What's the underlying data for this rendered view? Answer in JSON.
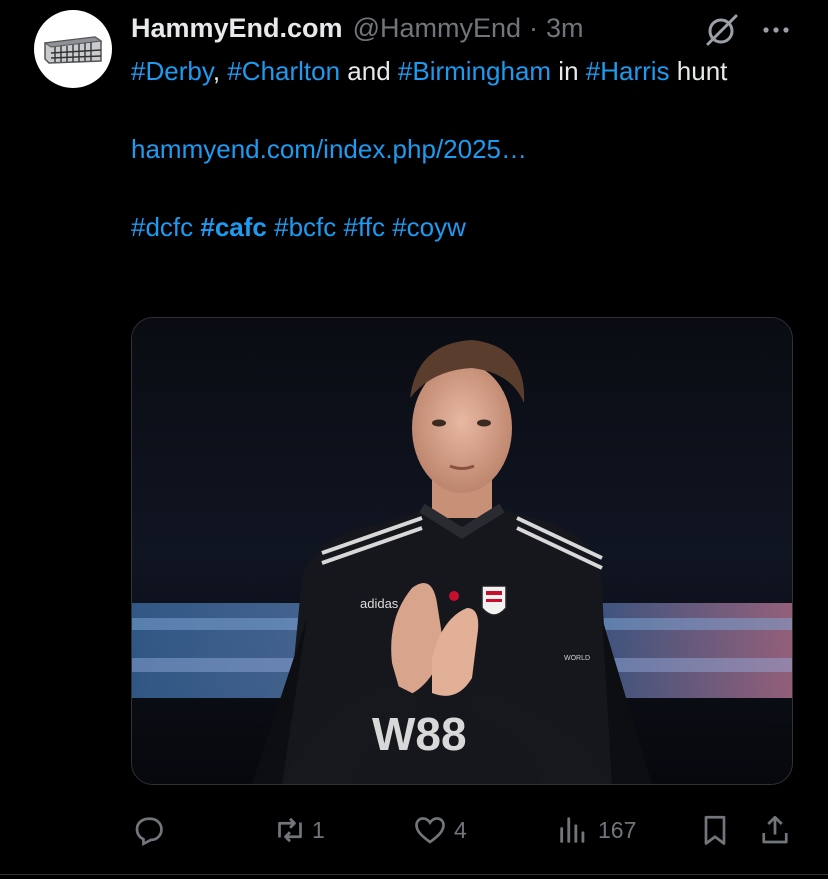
{
  "author": {
    "name": "HammyEnd.com",
    "handle": "@HammyEnd",
    "separator": "·",
    "time": "3m"
  },
  "tweet": {
    "line1": [
      {
        "t": "#Derby",
        "type": "tag"
      },
      {
        "t": ", ",
        "type": "text"
      },
      {
        "t": "#Charlton",
        "type": "tag"
      },
      {
        "t": " and ",
        "type": "text"
      },
      {
        "t": "#Birmingham",
        "type": "tag"
      },
      {
        "t": " in ",
        "type": "text"
      },
      {
        "t": "#Harris",
        "type": "tag"
      },
      {
        "t": " hunt",
        "type": "text"
      }
    ],
    "link": "hammyend.com/index.php/2025…",
    "hashtags": [
      {
        "t": "#dcfc",
        "bold": false
      },
      {
        "t": "#cafc",
        "bold": true
      },
      {
        "t": "#bcfc",
        "bold": false
      },
      {
        "t": "#ffc",
        "bold": false
      },
      {
        "t": "#coyw",
        "bold": false
      }
    ]
  },
  "media": {
    "shirt_sponsor": "W88",
    "kit_brand": "adidas",
    "badge_text": "WORLD"
  },
  "actions": {
    "reply_count": "",
    "retweet_count": "1",
    "like_count": "4",
    "views_count": "167"
  },
  "colors": {
    "accent": "#1d9bf0",
    "muted": "#71767b",
    "text": "#e7e9ea",
    "bg": "#000000"
  },
  "icons": [
    "avatar-logo-icon",
    "grok-icon",
    "more-icon",
    "reply-icon",
    "retweet-icon",
    "like-icon",
    "views-icon",
    "bookmark-icon",
    "share-icon"
  ]
}
